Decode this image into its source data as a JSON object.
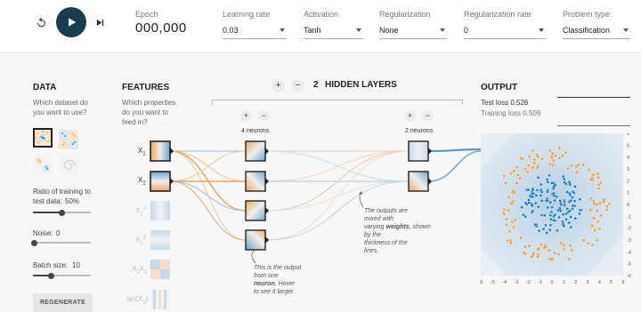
{
  "header": {
    "epoch_label": "Epoch",
    "epoch_value": "000,000",
    "learning_rate": {
      "label": "Learning rate",
      "value": "0.03"
    },
    "activation": {
      "label": "Activation",
      "value": "Tanh"
    },
    "regularization": {
      "label": "Regularization",
      "value": "None"
    },
    "regularization_rate": {
      "label": "Regularization rate",
      "value": "0"
    },
    "problem_type": {
      "label": "Problem type",
      "value": "Classification"
    }
  },
  "data_panel": {
    "title": "DATA",
    "subtitle_1": "Which dataset do",
    "subtitle_2": "you want to use?",
    "ratio_label_1": "Ratio of training to",
    "ratio_label_2": "test data:",
    "ratio_value": "50%",
    "ratio_fraction": 0.5,
    "noise_label": "Noise:",
    "noise_value": "0",
    "noise_fraction": 0.0,
    "batch_label": "Batch size:",
    "batch_value": "10",
    "batch_fraction": 0.3,
    "regenerate": "REGENERATE"
  },
  "features_panel": {
    "title": "FEATURES",
    "subtitle_1": "Which properties",
    "subtitle_2": "do you want to",
    "subtitle_3": "feed in?",
    "features": [
      "X1",
      "X2",
      "X1²",
      "X2²",
      "X1X2",
      "sin(X1)"
    ]
  },
  "network": {
    "hidden_layers_count": "2",
    "hidden_layers_label": "HIDDEN LAYERS",
    "layer1_neurons": "4 neurons",
    "layer2_neurons": "2 neurons",
    "plus": "+",
    "minus": "−",
    "note_output_1": "This is the output",
    "note_output_2": "from one",
    "note_output_3": "neuron",
    "note_output_4": ". Hover",
    "note_output_5": "to see it larger.",
    "note_weights_1": "The outputs are",
    "note_weights_2": "mixed with",
    "note_weights_3": "varying",
    "note_weights_4": "weights",
    "note_weights_5": ", shown by the",
    "note_weights_6": "thickness of the",
    "note_weights_7": "lines."
  },
  "output_panel": {
    "title": "OUTPUT",
    "test_loss_label": "Test loss",
    "test_loss_value": "0.526",
    "training_loss_label": "Training loss",
    "training_loss_value": "0.509",
    "x_ticks": [
      "-6",
      "-5",
      "-4",
      "-3",
      "-2",
      "-1",
      "0",
      "1",
      "2",
      "3",
      "4",
      "5",
      "6"
    ],
    "y_ticks": [
      "6",
      "5",
      "4",
      "3",
      "2",
      "1",
      "0",
      "-1",
      "-2",
      "-3",
      "-4",
      "-5",
      "-6"
    ]
  },
  "colors": {
    "orange": "#f59322",
    "blue": "#0877bd",
    "play_button": "#183d4e"
  }
}
